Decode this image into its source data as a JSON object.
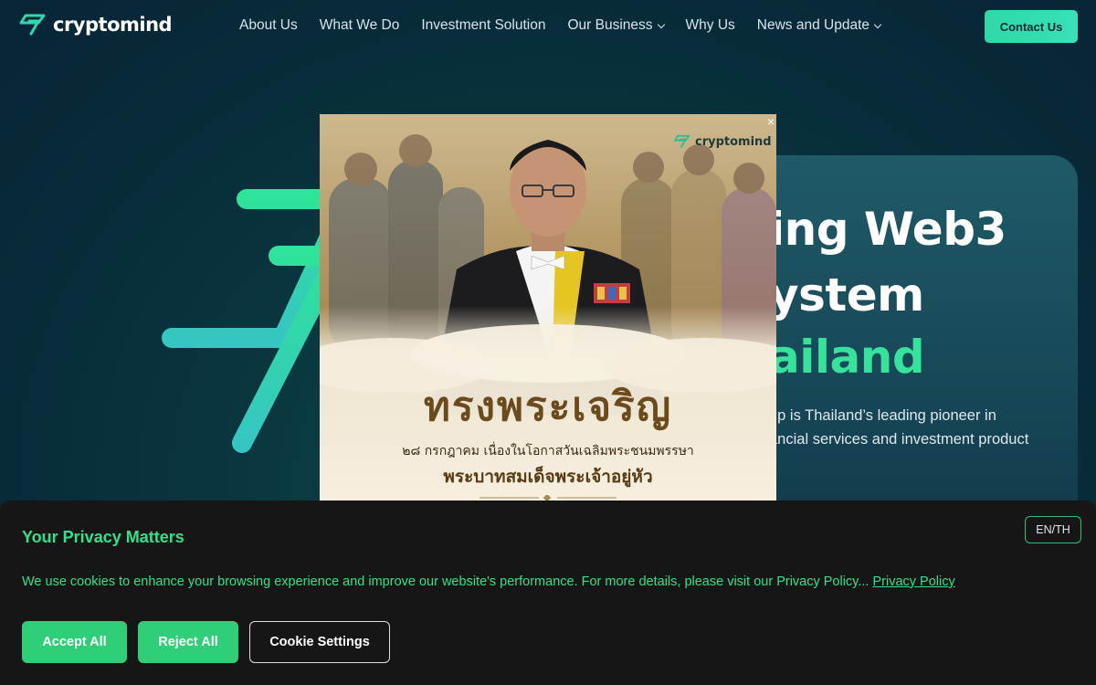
{
  "brand": {
    "name": "cryptomind",
    "accent": "#35e39a",
    "accent_teal": "#2fd9a6"
  },
  "nav": {
    "links": [
      {
        "label": "About Us",
        "dropdown": false
      },
      {
        "label": "What We Do",
        "dropdown": false
      },
      {
        "label": "Investment Solution",
        "dropdown": false
      },
      {
        "label": "Our Business",
        "dropdown": true
      },
      {
        "label": "Why Us",
        "dropdown": false
      },
      {
        "label": "News and Update",
        "dropdown": true
      }
    ],
    "contact_label": "Contact Us"
  },
  "hero": {
    "line1": "ing Web3",
    "line2": "ystem",
    "line3": "ailand",
    "desc_line1": "up is Thailand’s leading pioneer in",
    "desc_line2": "ancial services and investment product"
  },
  "popup": {
    "logo_text": "cryptomind",
    "close_label": "×",
    "title": "ทรงพระเจริญ",
    "subtitle": "๒๘ กรกฎาคม  เนื่องในโอกาสวันเฉลิมพระชนมพรรษา",
    "royal_name": "พระบาทสมเด็จพระเจ้าอยู่หัว"
  },
  "cookie": {
    "title": "Your Privacy Matters",
    "lang_label": "EN/TH",
    "text": "We use cookies to enhance your browsing experience and improve our website's performance. For more details, please visit our Privacy Policy... ",
    "policy_link": "Privacy Policy",
    "accept_label": "Accept All",
    "reject_label": "Reject All",
    "settings_label": "Cookie Settings"
  }
}
